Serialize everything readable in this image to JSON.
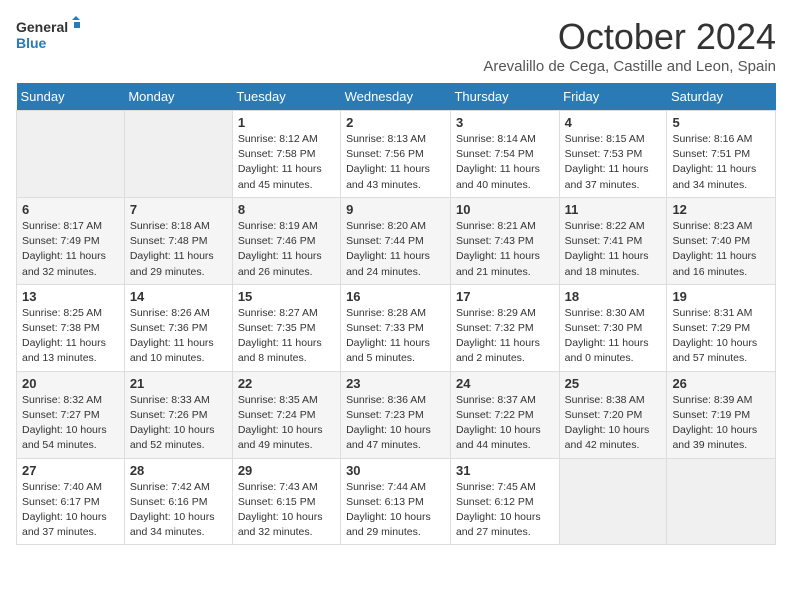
{
  "header": {
    "logo_line1": "General",
    "logo_line2": "Blue",
    "month": "October 2024",
    "location": "Arevalillo de Cega, Castille and Leon, Spain"
  },
  "weekdays": [
    "Sunday",
    "Monday",
    "Tuesday",
    "Wednesday",
    "Thursday",
    "Friday",
    "Saturday"
  ],
  "weeks": [
    [
      {
        "day": "",
        "empty": true
      },
      {
        "day": "",
        "empty": true
      },
      {
        "day": "1",
        "sunrise": "8:12 AM",
        "sunset": "7:58 PM",
        "daylight": "11 hours and 45 minutes."
      },
      {
        "day": "2",
        "sunrise": "8:13 AM",
        "sunset": "7:56 PM",
        "daylight": "11 hours and 43 minutes."
      },
      {
        "day": "3",
        "sunrise": "8:14 AM",
        "sunset": "7:54 PM",
        "daylight": "11 hours and 40 minutes."
      },
      {
        "day": "4",
        "sunrise": "8:15 AM",
        "sunset": "7:53 PM",
        "daylight": "11 hours and 37 minutes."
      },
      {
        "day": "5",
        "sunrise": "8:16 AM",
        "sunset": "7:51 PM",
        "daylight": "11 hours and 34 minutes."
      }
    ],
    [
      {
        "day": "6",
        "sunrise": "8:17 AM",
        "sunset": "7:49 PM",
        "daylight": "11 hours and 32 minutes."
      },
      {
        "day": "7",
        "sunrise": "8:18 AM",
        "sunset": "7:48 PM",
        "daylight": "11 hours and 29 minutes."
      },
      {
        "day": "8",
        "sunrise": "8:19 AM",
        "sunset": "7:46 PM",
        "daylight": "11 hours and 26 minutes."
      },
      {
        "day": "9",
        "sunrise": "8:20 AM",
        "sunset": "7:44 PM",
        "daylight": "11 hours and 24 minutes."
      },
      {
        "day": "10",
        "sunrise": "8:21 AM",
        "sunset": "7:43 PM",
        "daylight": "11 hours and 21 minutes."
      },
      {
        "day": "11",
        "sunrise": "8:22 AM",
        "sunset": "7:41 PM",
        "daylight": "11 hours and 18 minutes."
      },
      {
        "day": "12",
        "sunrise": "8:23 AM",
        "sunset": "7:40 PM",
        "daylight": "11 hours and 16 minutes."
      }
    ],
    [
      {
        "day": "13",
        "sunrise": "8:25 AM",
        "sunset": "7:38 PM",
        "daylight": "11 hours and 13 minutes."
      },
      {
        "day": "14",
        "sunrise": "8:26 AM",
        "sunset": "7:36 PM",
        "daylight": "11 hours and 10 minutes."
      },
      {
        "day": "15",
        "sunrise": "8:27 AM",
        "sunset": "7:35 PM",
        "daylight": "11 hours and 8 minutes."
      },
      {
        "day": "16",
        "sunrise": "8:28 AM",
        "sunset": "7:33 PM",
        "daylight": "11 hours and 5 minutes."
      },
      {
        "day": "17",
        "sunrise": "8:29 AM",
        "sunset": "7:32 PM",
        "daylight": "11 hours and 2 minutes."
      },
      {
        "day": "18",
        "sunrise": "8:30 AM",
        "sunset": "7:30 PM",
        "daylight": "11 hours and 0 minutes."
      },
      {
        "day": "19",
        "sunrise": "8:31 AM",
        "sunset": "7:29 PM",
        "daylight": "10 hours and 57 minutes."
      }
    ],
    [
      {
        "day": "20",
        "sunrise": "8:32 AM",
        "sunset": "7:27 PM",
        "daylight": "10 hours and 54 minutes."
      },
      {
        "day": "21",
        "sunrise": "8:33 AM",
        "sunset": "7:26 PM",
        "daylight": "10 hours and 52 minutes."
      },
      {
        "day": "22",
        "sunrise": "8:35 AM",
        "sunset": "7:24 PM",
        "daylight": "10 hours and 49 minutes."
      },
      {
        "day": "23",
        "sunrise": "8:36 AM",
        "sunset": "7:23 PM",
        "daylight": "10 hours and 47 minutes."
      },
      {
        "day": "24",
        "sunrise": "8:37 AM",
        "sunset": "7:22 PM",
        "daylight": "10 hours and 44 minutes."
      },
      {
        "day": "25",
        "sunrise": "8:38 AM",
        "sunset": "7:20 PM",
        "daylight": "10 hours and 42 minutes."
      },
      {
        "day": "26",
        "sunrise": "8:39 AM",
        "sunset": "7:19 PM",
        "daylight": "10 hours and 39 minutes."
      }
    ],
    [
      {
        "day": "27",
        "sunrise": "7:40 AM",
        "sunset": "6:17 PM",
        "daylight": "10 hours and 37 minutes."
      },
      {
        "day": "28",
        "sunrise": "7:42 AM",
        "sunset": "6:16 PM",
        "daylight": "10 hours and 34 minutes."
      },
      {
        "day": "29",
        "sunrise": "7:43 AM",
        "sunset": "6:15 PM",
        "daylight": "10 hours and 32 minutes."
      },
      {
        "day": "30",
        "sunrise": "7:44 AM",
        "sunset": "6:13 PM",
        "daylight": "10 hours and 29 minutes."
      },
      {
        "day": "31",
        "sunrise": "7:45 AM",
        "sunset": "6:12 PM",
        "daylight": "10 hours and 27 minutes."
      },
      {
        "day": "",
        "empty": true
      },
      {
        "day": "",
        "empty": true
      }
    ]
  ],
  "labels": {
    "sunrise": "Sunrise:",
    "sunset": "Sunset:",
    "daylight": "Daylight:"
  }
}
